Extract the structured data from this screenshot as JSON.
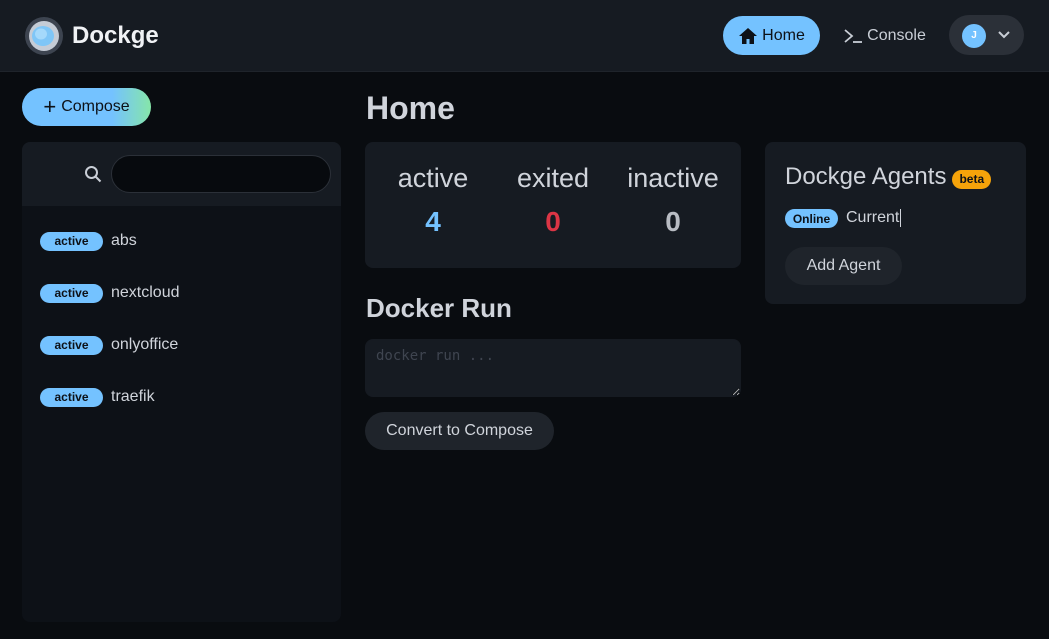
{
  "brand": {
    "title": "Dockge"
  },
  "nav": {
    "home_label": "Home",
    "console_label": "Console",
    "user_initial": "J"
  },
  "sidebar": {
    "compose_label": "Compose",
    "search": {
      "value": "",
      "placeholder": ""
    },
    "stacks": [
      {
        "status": "active",
        "name": "abs"
      },
      {
        "status": "active",
        "name": "nextcloud"
      },
      {
        "status": "active",
        "name": "onlyoffice"
      },
      {
        "status": "active",
        "name": "traefik"
      }
    ]
  },
  "main": {
    "title": "Home",
    "stats": [
      {
        "label": "active",
        "value": "4",
        "color": "#74c2ff"
      },
      {
        "label": "exited",
        "value": "0",
        "color": "#dc3545"
      },
      {
        "label": "inactive",
        "value": "0",
        "color": "#b8bcc3"
      }
    ],
    "docker_run": {
      "title": "Docker Run",
      "placeholder": "docker run ...",
      "convert_label": "Convert to Compose"
    }
  },
  "agents": {
    "title": "Dockge Agents",
    "beta_label": "beta",
    "items": [
      {
        "status": "Online",
        "name": "Current"
      }
    ],
    "add_label": "Add Agent"
  },
  "colors": {
    "accent": "#74c2ff",
    "accent_gradient_end": "#86e6a9",
    "header_bg": "#161b22",
    "page_bg": "#090c10",
    "beta": "#f5a30a",
    "danger": "#dc3545"
  },
  "icons": {
    "logo": "dockge-logo-icon",
    "home": "house-icon",
    "console": "terminal-prompt-icon",
    "user_menu": "chevron-down-icon",
    "compose": "plus-icon",
    "search": "search-icon"
  }
}
